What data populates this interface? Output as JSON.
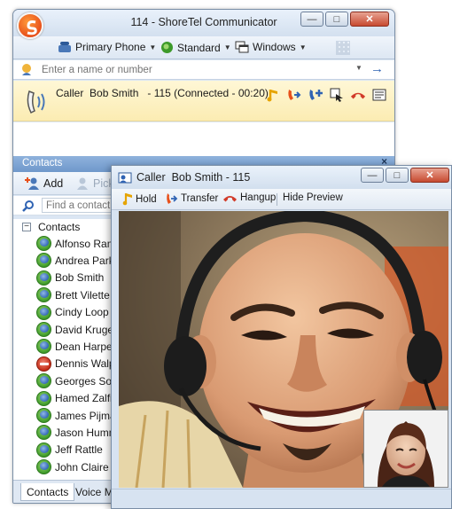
{
  "main_window": {
    "title": "114 - ShoreTel Communicator",
    "toolbar": {
      "phone_label": "Primary Phone",
      "mode_label": "Standard",
      "view_label": "Windows"
    },
    "search": {
      "placeholder": "Enter a name or number"
    },
    "active_call": {
      "text": "Caller  Bob Smith   - 115 (Connected - 00:20)"
    }
  },
  "contacts_panel": {
    "header": "Contacts",
    "close_glyph": "×",
    "add_label": "Add",
    "pick_label": "Pick",
    "find_placeholder": "Find a contact",
    "group_label": "Contacts",
    "items": [
      {
        "name": "Alfonso Ramos",
        "status": "available"
      },
      {
        "name": "Andrea Parker",
        "status": "available"
      },
      {
        "name": "Bob Smith",
        "status": "available"
      },
      {
        "name": "Brett Vilette",
        "status": "available"
      },
      {
        "name": "Cindy Loop",
        "status": "available"
      },
      {
        "name": "David Kruger",
        "status": "available"
      },
      {
        "name": "Dean Harper",
        "status": "available"
      },
      {
        "name": "Dennis Walpe",
        "status": "busy"
      },
      {
        "name": "Georges Solm",
        "status": "available"
      },
      {
        "name": "Hamed Zalfi",
        "status": "available"
      },
      {
        "name": "James Pijman",
        "status": "available"
      },
      {
        "name": "Jason Hummel",
        "status": "available"
      },
      {
        "name": "Jeff Rattle",
        "status": "available"
      },
      {
        "name": "John Claire",
        "status": "available"
      }
    ],
    "tabs": [
      "Contacts",
      "Voice Mail"
    ]
  },
  "video_window": {
    "title": "Caller  Bob Smith - 115",
    "toolbar": {
      "hold_label": "Hold",
      "transfer_label": "Transfer",
      "hangup_label": "Hangup",
      "preview_label": "Hide Preview"
    }
  },
  "colors": {
    "accent": "#6f98cb",
    "call_highlight": "#fbecb2",
    "presence_available": "#3d9a2a",
    "presence_busy": "#c42b16"
  }
}
